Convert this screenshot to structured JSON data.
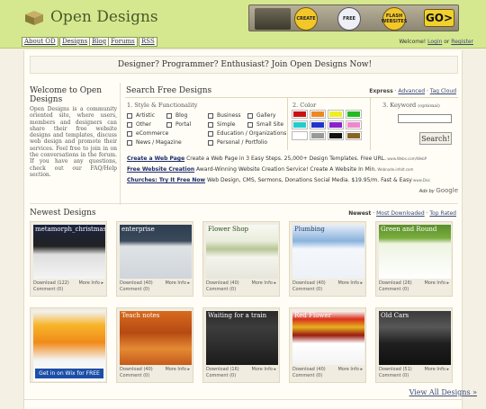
{
  "header": {
    "site_name": "Open Designs",
    "banner": {
      "create": "CREATE",
      "free": "FREE",
      "flash": "FLASH WEBSITES",
      "go": "GO>"
    }
  },
  "nav": {
    "links": [
      "About OD",
      "Designs",
      "Blog",
      "Forums",
      "RSS"
    ],
    "welcome": "Welcome!",
    "login": "Login",
    "or": "or",
    "register": "Register"
  },
  "tagline": "Designer? Programmer? Enthusiast? Join Open Designs Now!",
  "about": {
    "title": "Welcome to Open Designs",
    "text": "Open Designs is a community oriented site, where users, members and designers can share their free website designs and templates, discuss web design and promote their services. Feel free to join in on the conversations in the forum. If you have any questions, check out our FAQ/Help section."
  },
  "search": {
    "title": "Search Free Designs",
    "mode": "Express",
    "advanced": "Advanced",
    "tag_cloud": "Tag Cloud",
    "style_label": "1. Style & Functionality",
    "color_label": "2. Color",
    "keyword_label": "3. Keyword",
    "keyword_optional": "(optional)",
    "styles_col1": [
      "Artistic",
      "Other",
      "eCommerce",
      "News / Magazine"
    ],
    "styles_col2": [
      "Blog",
      "Portal"
    ],
    "styles_col3": [
      "Business",
      "Simple",
      "Education / Organizations",
      "Personal / Portfolio"
    ],
    "styles_col4": [
      "Gallery",
      "Small Site"
    ],
    "colors": [
      "#cc1111",
      "#ee8822",
      "#eeee22",
      "#22bb22",
      "#22cccc",
      "#2233cc",
      "#8822cc",
      "#ee88cc",
      "#ffffff",
      "#999999",
      "#111111",
      "#886622"
    ],
    "button": "Search!"
  },
  "ads": [
    {
      "title": "Create a Web Page",
      "text": " Create a Web Page in 3 Easy Steps. 25,000+ Design Templates. Free URL.",
      "url": " www.Webs.com/WebP"
    },
    {
      "title": "Free Website Creation",
      "text": " Award-Winning Website Creation Service! Create A Website In Min.",
      "url": " Webnode.infolt.com"
    },
    {
      "title": "Churches: Try It Free Now",
      "text": " Web Design, CMS, Sermons, Donations Social Media. $19.95/m. Fast & Easy",
      "url": " www.Disc"
    }
  ],
  "ads_by": "Ads by",
  "ads_brand": "Google",
  "newest": {
    "title": "Newest Designs",
    "sort_newest": "Newest",
    "sort_downloaded": "Most Downloaded",
    "sort_rated": "Top Rated",
    "view_all": "View All Designs »",
    "more_info": "More Info",
    "cards": [
      {
        "name": "metamorph_christmas",
        "download": "Download (122)",
        "comment": "Comment (0)"
      },
      {
        "name": "enterprise",
        "download": "Download (40)",
        "comment": "Comment (0)"
      },
      {
        "name": "Flower Shop",
        "download": "Download (40)",
        "comment": "Comment (0)"
      },
      {
        "name": "Plumbing",
        "download": "Download (40)",
        "comment": "Comment (0)"
      },
      {
        "name": "Green and Round",
        "download": "Download (26)",
        "comment": "Comment (0)"
      },
      {
        "name": "Get in on Wix for FREE",
        "download": "",
        "comment": ""
      },
      {
        "name": "Teach notes",
        "download": "Download (40)",
        "comment": "Comment (0)"
      },
      {
        "name": "Waiting for a train",
        "download": "Download (16)",
        "comment": "Comment (0)"
      },
      {
        "name": "Red Flower",
        "download": "Download (40)",
        "comment": "Comment (0)"
      },
      {
        "name": "Old Cars",
        "download": "Download (51)",
        "comment": "Comment (0)"
      }
    ]
  }
}
